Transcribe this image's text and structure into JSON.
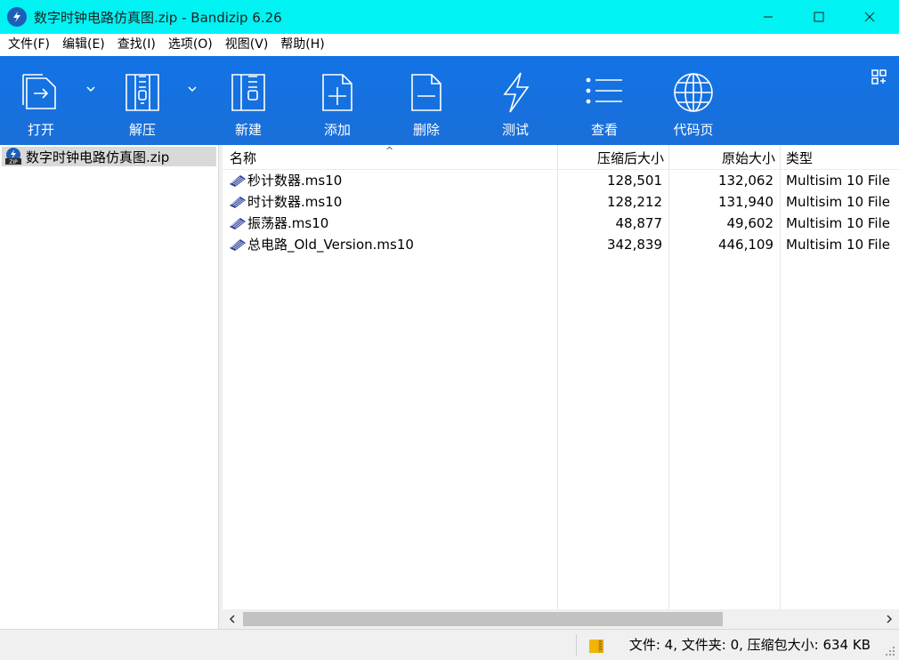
{
  "window": {
    "title": "数字时钟电路仿真图.zip - Bandizip 6.26",
    "title_bar_color": "#00f2f2"
  },
  "menu": [
    "文件(F)",
    "编辑(E)",
    "查找(I)",
    "选项(O)",
    "视图(V)",
    "帮助(H)"
  ],
  "toolbar": {
    "background": "#1273e6",
    "buttons": [
      {
        "label": "打开",
        "icon": "open-icon",
        "has_dropdown": true
      },
      {
        "label": "解压",
        "icon": "extract-icon",
        "has_dropdown": true
      },
      {
        "label": "新建",
        "icon": "new-archive-icon",
        "has_dropdown": false
      },
      {
        "label": "添加",
        "icon": "add-icon",
        "has_dropdown": false
      },
      {
        "label": "删除",
        "icon": "delete-icon",
        "has_dropdown": false
      },
      {
        "label": "测试",
        "icon": "test-icon",
        "has_dropdown": false
      },
      {
        "label": "查看",
        "icon": "view-icon",
        "has_dropdown": false
      },
      {
        "label": "代码页",
        "icon": "codepage-icon",
        "has_dropdown": false
      }
    ],
    "layout_icon": "layout-grid-icon"
  },
  "tree": {
    "archive": "数字时钟电路仿真图.zip",
    "icon": "zip-icon"
  },
  "list": {
    "columns": {
      "name": "名称",
      "compressed": "压缩后大小",
      "original": "原始大小",
      "type": "类型"
    },
    "sort_indicator": "^",
    "rows": [
      {
        "name": "秒计数器.ms10",
        "compressed": "128,501",
        "original": "132,062",
        "type": "Multisim 10 File"
      },
      {
        "name": "时计数器.ms10",
        "compressed": "128,212",
        "original": "131,940",
        "type": "Multisim 10 File"
      },
      {
        "name": "振荡器.ms10",
        "compressed": "48,877",
        "original": "49,602",
        "type": "Multisim 10 File"
      },
      {
        "name": "总电路_Old_Version.ms10",
        "compressed": "342,839",
        "original": "446,109",
        "type": "Multisim 10 File"
      }
    ]
  },
  "status": {
    "text": "文件: 4, 文件夹: 0, 压缩包大小: 634 KB"
  }
}
